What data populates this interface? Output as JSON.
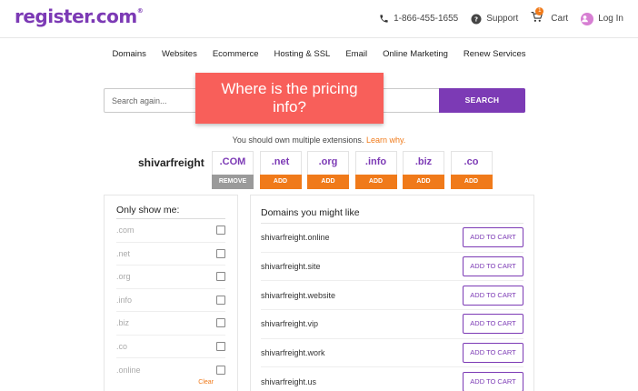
{
  "header": {
    "logo": "register.com",
    "logo_mark": "®",
    "phone": "1-866-455-1655",
    "support": "Support",
    "cart": "Cart",
    "cart_count": "1",
    "login": "Log In"
  },
  "nav": {
    "items": [
      "Domains",
      "Websites",
      "Ecommerce",
      "Hosting & SSL",
      "Email",
      "Online Marketing",
      "Renew Services"
    ]
  },
  "search": {
    "placeholder": "Search again...",
    "button": "SEARCH"
  },
  "callout": {
    "text": "Where is the pricing\ninfo?"
  },
  "promo": {
    "text": "You should own multiple extensions.",
    "link": "Learn why."
  },
  "domain": {
    "name": "shivarfreight",
    "extensions": [
      {
        "ext": ".COM",
        "action": "REMOVE"
      },
      {
        "ext": ".net",
        "action": "ADD"
      },
      {
        "ext": ".org",
        "action": "ADD"
      },
      {
        "ext": ".info",
        "action": "ADD"
      },
      {
        "ext": ".biz",
        "action": "ADD"
      },
      {
        "ext": ".co",
        "action": "ADD"
      }
    ]
  },
  "filter": {
    "title": "Only show me:",
    "options": [
      ".com",
      ".net",
      ".org",
      ".info",
      ".biz",
      ".co",
      ".online"
    ],
    "clear": "Clear"
  },
  "suggestions": {
    "title": "Domains you might like",
    "button_label": "ADD TO CART",
    "items": [
      "shivarfreight.online",
      "shivarfreight.site",
      "shivarfreight.website",
      "shivarfreight.vip",
      "shivarfreight.work",
      "shivarfreight.us"
    ]
  },
  "colors": {
    "brand_purple": "#7c3ab5",
    "accent_orange": "#f07a1a",
    "callout_red": "#f85f5a"
  }
}
